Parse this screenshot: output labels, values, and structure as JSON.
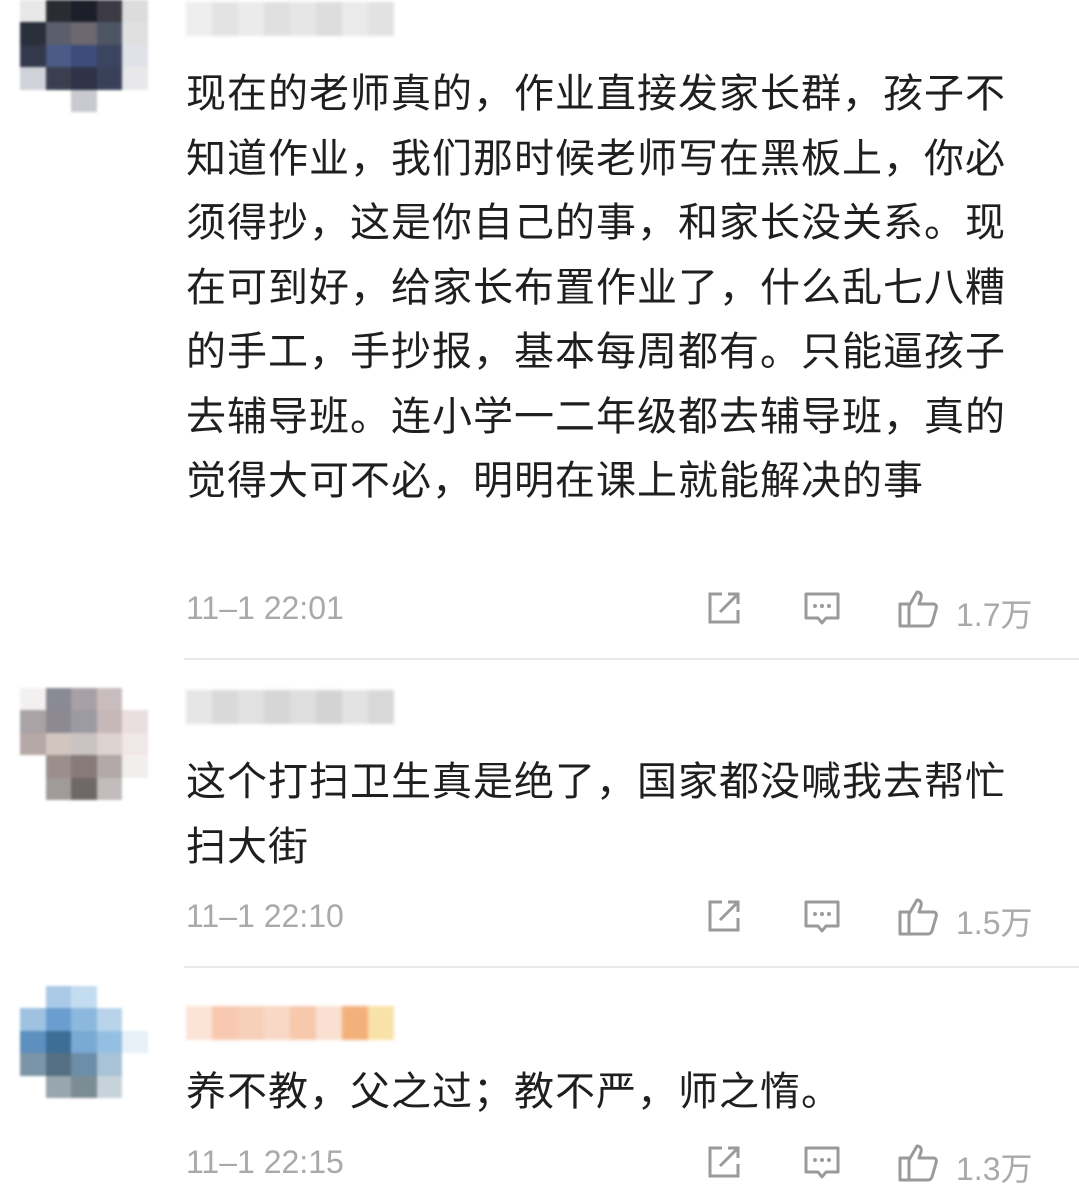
{
  "comments": [
    {
      "text": "现在的老师真的，作业直接发家长群，孩子不知道作业，我们那时候老师写在黑板上，你必须得抄，这是你自己的事，和家长没关系。现在可到好，给家长布置作业了，什么乱七八糟的手工，手抄报，基本每周都有。只能逼孩子去辅导班。连小学一二年级都去辅导班，真的觉得大可不必，明明在课上就能解决的事",
      "time": "11–1 22:01",
      "likes": "1.7万",
      "avatar_colors": [
        "#e8e8e8",
        "#2b2b33",
        "#1c1f2a",
        "#3c3a44",
        "#dcdcdc",
        "#2a2f3c",
        "#5b5e6c",
        "#6d6770",
        "#4d5565",
        "#e0e0e0",
        "#33384a",
        "#4b5a86",
        "#3d4c7a",
        "#3b4560",
        "#dfe2e8",
        "#cfd2d8",
        "#3a3f50",
        "#2e3348",
        "#39415a",
        "#e8e8ea",
        "#ffffff",
        "#ffffff",
        "#c8cad0",
        "#ffffff",
        "#ffffff"
      ],
      "name_colors": [
        "#eeeeee",
        "#e3e3e3",
        "#ebebeb",
        "#e0e0e0",
        "#e6e6e6",
        "#dddddd",
        "#eaeaea",
        "#e2e2e2"
      ]
    },
    {
      "text": "这个打扫卫生真是绝了，国家都没喊我去帮忙扫大街",
      "time": "11–1 22:10",
      "likes": "1.5万",
      "avatar_colors": [
        "#f3f0f0",
        "#8a8a94",
        "#a7a0a6",
        "#c9bcbe",
        "#ffffff",
        "#a9a3a6",
        "#8d8991",
        "#9c9aa2",
        "#c6b8b9",
        "#e9dede",
        "#b6a8a6",
        "#d2c5c0",
        "#c9c3c1",
        "#dcd2cf",
        "#f0e8e6",
        "#ffffff",
        "#9b8f8c",
        "#877b79",
        "#b2a9a8",
        "#f3eeee",
        "#ffffff",
        "#a19a9a",
        "#6f6868",
        "#c2bcbc",
        "#ffffff"
      ],
      "name_colors": [
        "#e6e6e6",
        "#d9d9d9",
        "#e1e1e1",
        "#d6d6d6",
        "#dedede",
        "#d3d3d3",
        "#e3e3e3",
        "#d8d8d8"
      ]
    },
    {
      "text": "养不教，父之过；教不严，师之惰。",
      "time": "11–1 22:15",
      "likes": "1.3万",
      "avatar_colors": [
        "#ffffff",
        "#a9c9e6",
        "#c3dcef",
        "#ffffff",
        "#ffffff",
        "#9ec2e0",
        "#6b9ed0",
        "#8db8de",
        "#b9d4ea",
        "#ffffff",
        "#5d8fbf",
        "#3e6d96",
        "#7aa9d4",
        "#95bfe2",
        "#e8f0f8",
        "#7b95a8",
        "#556f82",
        "#6d8ea8",
        "#a8c2d6",
        "#ffffff",
        "#ffffff",
        "#98a6ae",
        "#7c8c94",
        "#c7d3da",
        "#ffffff"
      ],
      "name_colors": [
        "#fbe3d6",
        "#f8c9b0",
        "#f6d0b8",
        "#f9d8c6",
        "#f7c8ac",
        "#fae0d0",
        "#f4b07a",
        "#f8e2a8"
      ]
    }
  ]
}
